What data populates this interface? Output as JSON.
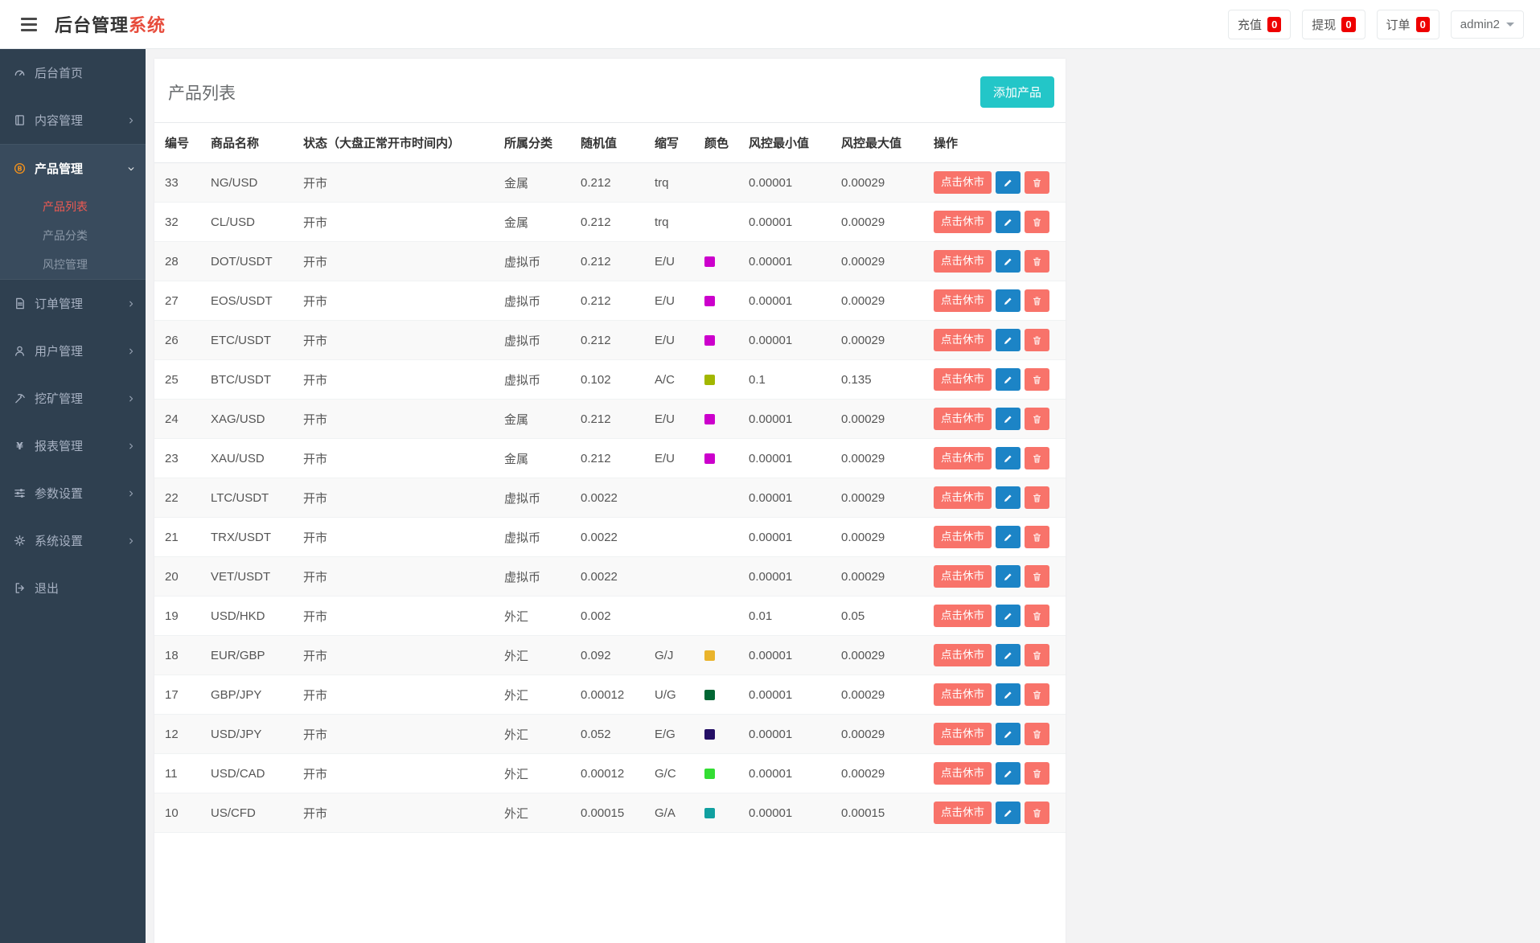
{
  "colors": {
    "accent": "#23c6c8",
    "danger": "#f8736a",
    "primary": "#1c84c6",
    "badge": "#ee0000",
    "title-accent": "#e74c3c",
    "bitcoin": "#f7931a",
    "submenu-active": "#ee5a52"
  },
  "header": {
    "title_main": "后台管理",
    "title_accent": "系统",
    "actions": [
      {
        "key": "recharge",
        "label": "充值",
        "count": "0"
      },
      {
        "key": "withdraw",
        "label": "提现",
        "count": "0"
      },
      {
        "key": "order",
        "label": "订单",
        "count": "0"
      }
    ],
    "user": {
      "name": "admin2"
    }
  },
  "sidebar": {
    "items": [
      {
        "key": "home",
        "icon": "dashboard-icon",
        "label": "后台首页"
      },
      {
        "key": "content",
        "icon": "book-icon",
        "label": "内容管理",
        "expandable": true
      },
      {
        "key": "product",
        "icon": "bitcoin-icon",
        "label": "产品管理",
        "expandable": true,
        "active": true,
        "open": true,
        "children": [
          {
            "key": "product-list",
            "label": "产品列表",
            "active": true
          },
          {
            "key": "product-category",
            "label": "产品分类"
          },
          {
            "key": "risk-control",
            "label": "风控管理"
          }
        ]
      },
      {
        "key": "orders",
        "icon": "orders-icon",
        "label": "订单管理",
        "expandable": true
      },
      {
        "key": "users",
        "icon": "user-icon",
        "label": "用户管理",
        "expandable": true
      },
      {
        "key": "mining",
        "icon": "mining-icon",
        "label": "挖矿管理",
        "expandable": true
      },
      {
        "key": "reports",
        "icon": "reports-icon",
        "label": "报表管理",
        "expandable": true
      },
      {
        "key": "params",
        "icon": "params-icon",
        "label": "参数设置",
        "expandable": true
      },
      {
        "key": "system",
        "icon": "settings-icon",
        "label": "系统设置",
        "expandable": true
      },
      {
        "key": "logout",
        "icon": "logout-icon",
        "label": "退出"
      }
    ]
  },
  "main": {
    "card_title": "产品列表",
    "add_button_label": "添加产品",
    "table": {
      "headers": [
        "编号",
        "商品名称",
        "状态（大盘正常开市时间内）",
        "所属分类",
        "随机值",
        "缩写",
        "颜色",
        "风控最小值",
        "风控最大值",
        "操作"
      ],
      "actions": {
        "suspend_label": "点击休市",
        "edit_icon": "pencil-icon",
        "delete_icon": "trash-icon"
      },
      "rows": [
        {
          "id": "33",
          "name": "NG/USD",
          "status": "开市",
          "category": "金属",
          "random": "0.212",
          "abbr": "trq",
          "color": "",
          "risk_min": "0.00001",
          "risk_max": "0.00029"
        },
        {
          "id": "32",
          "name": "CL/USD",
          "status": "开市",
          "category": "金属",
          "random": "0.212",
          "abbr": "trq",
          "color": "",
          "risk_min": "0.00001",
          "risk_max": "0.00029"
        },
        {
          "id": "28",
          "name": "DOT/USDT",
          "status": "开市",
          "category": "虚拟币",
          "random": "0.212",
          "abbr": "E/U",
          "color": "#cc00cc",
          "risk_min": "0.00001",
          "risk_max": "0.00029"
        },
        {
          "id": "27",
          "name": "EOS/USDT",
          "status": "开市",
          "category": "虚拟币",
          "random": "0.212",
          "abbr": "E/U",
          "color": "#cc00cc",
          "risk_min": "0.00001",
          "risk_max": "0.00029"
        },
        {
          "id": "26",
          "name": "ETC/USDT",
          "status": "开市",
          "category": "虚拟币",
          "random": "0.212",
          "abbr": "E/U",
          "color": "#cc00cc",
          "risk_min": "0.00001",
          "risk_max": "0.00029"
        },
        {
          "id": "25",
          "name": "BTC/USDT",
          "status": "开市",
          "category": "虚拟币",
          "random": "0.102",
          "abbr": "A/C",
          "color": "#a2b700",
          "risk_min": "0.1",
          "risk_max": "0.135"
        },
        {
          "id": "24",
          "name": "XAG/USD",
          "status": "开市",
          "category": "金属",
          "random": "0.212",
          "abbr": "E/U",
          "color": "#cc00cc",
          "risk_min": "0.00001",
          "risk_max": "0.00029"
        },
        {
          "id": "23",
          "name": "XAU/USD",
          "status": "开市",
          "category": "金属",
          "random": "0.212",
          "abbr": "E/U",
          "color": "#cc00cc",
          "risk_min": "0.00001",
          "risk_max": "0.00029"
        },
        {
          "id": "22",
          "name": "LTC/USDT",
          "status": "开市",
          "category": "虚拟币",
          "random": "0.0022",
          "abbr": "",
          "color": "",
          "risk_min": "0.00001",
          "risk_max": "0.00029"
        },
        {
          "id": "21",
          "name": "TRX/USDT",
          "status": "开市",
          "category": "虚拟币",
          "random": "0.0022",
          "abbr": "",
          "color": "",
          "risk_min": "0.00001",
          "risk_max": "0.00029"
        },
        {
          "id": "20",
          "name": "VET/USDT",
          "status": "开市",
          "category": "虚拟币",
          "random": "0.0022",
          "abbr": "",
          "color": "",
          "risk_min": "0.00001",
          "risk_max": "0.00029"
        },
        {
          "id": "19",
          "name": "USD/HKD",
          "status": "开市",
          "category": "外汇",
          "random": "0.002",
          "abbr": "",
          "color": "",
          "risk_min": "0.01",
          "risk_max": "0.05"
        },
        {
          "id": "18",
          "name": "EUR/GBP",
          "status": "开市",
          "category": "外汇",
          "random": "0.092",
          "abbr": "G/J",
          "color": "#eab42c",
          "risk_min": "0.00001",
          "risk_max": "0.00029"
        },
        {
          "id": "17",
          "name": "GBP/JPY",
          "status": "开市",
          "category": "外汇",
          "random": "0.00012",
          "abbr": "U/G",
          "color": "#006633",
          "risk_min": "0.00001",
          "risk_max": "0.00029"
        },
        {
          "id": "12",
          "name": "USD/JPY",
          "status": "开市",
          "category": "外汇",
          "random": "0.052",
          "abbr": "E/G",
          "color": "#240f66",
          "risk_min": "0.00001",
          "risk_max": "0.00029"
        },
        {
          "id": "11",
          "name": "USD/CAD",
          "status": "开市",
          "category": "外汇",
          "random": "0.00012",
          "abbr": "G/C",
          "color": "#33dd33",
          "risk_min": "0.00001",
          "risk_max": "0.00029"
        },
        {
          "id": "10",
          "name": "US/CFD",
          "status": "开市",
          "category": "外汇",
          "random": "0.00015",
          "abbr": "G/A",
          "color": "#11a0a0",
          "risk_min": "0.00001",
          "risk_max": "0.00015"
        }
      ]
    }
  }
}
